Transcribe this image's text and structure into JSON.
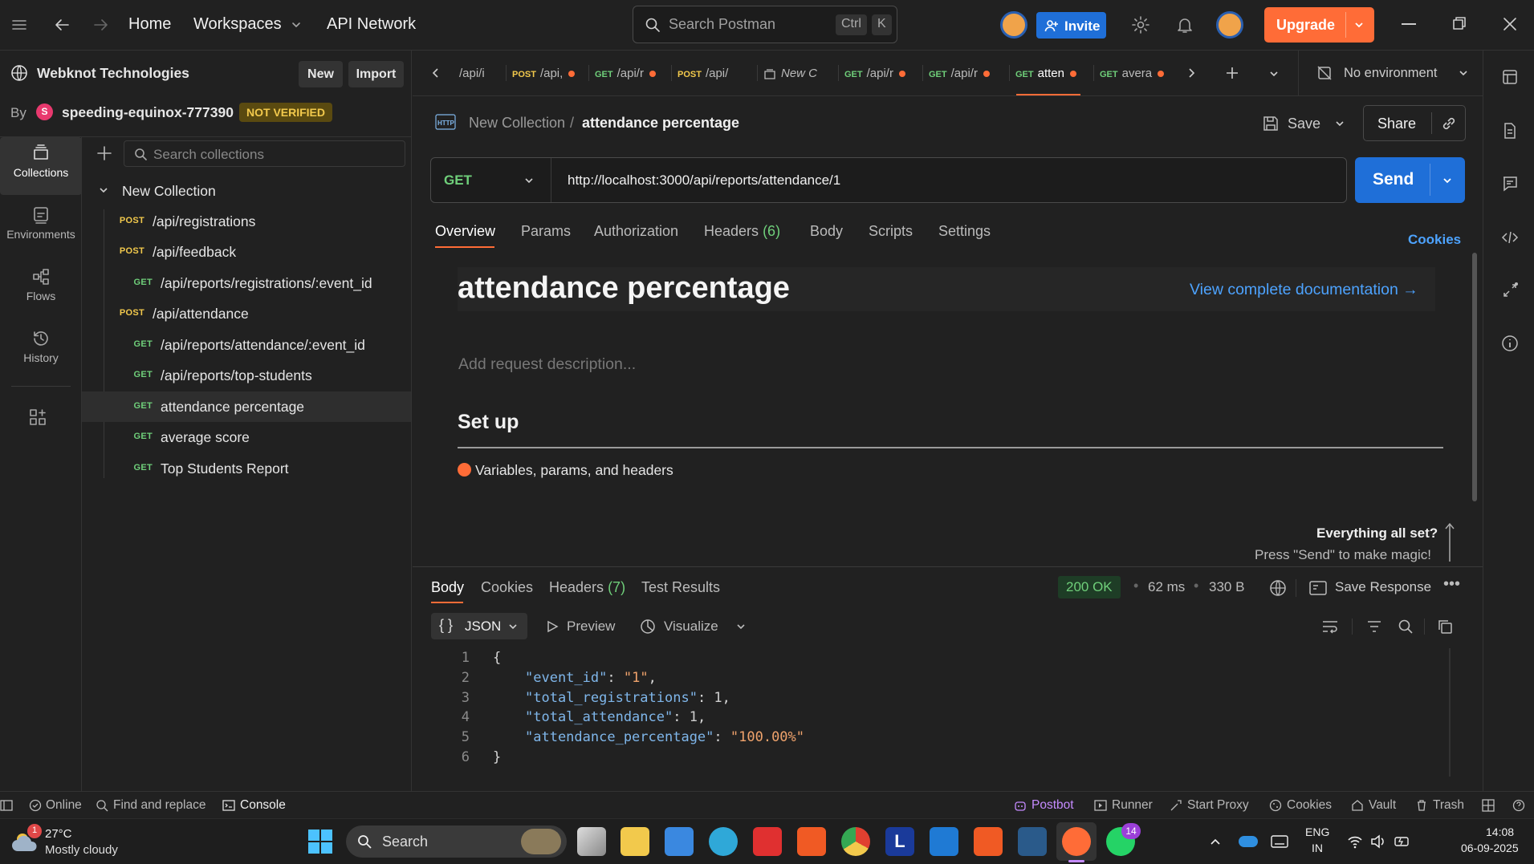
{
  "topbar": {
    "home": "Home",
    "workspaces": "Workspaces",
    "api_network": "API Network",
    "search_placeholder": "Search Postman",
    "kbd_ctrl": "Ctrl",
    "kbd_k": "K",
    "invite": "Invite",
    "upgrade": "Upgrade"
  },
  "workspace": {
    "name": "Webknot Technologies",
    "new": "New",
    "import": "Import",
    "by": "By",
    "avatar_letter": "S",
    "user": "speeding-equinox-777390",
    "badge": "NOT VERIFIED"
  },
  "rail": {
    "items": [
      {
        "label": "Collections",
        "icon": "collections-icon"
      },
      {
        "label": "Environments",
        "icon": "environments-icon"
      },
      {
        "label": "Flows",
        "icon": "flows-icon"
      },
      {
        "label": "History",
        "icon": "history-icon"
      }
    ]
  },
  "sidebar": {
    "search_placeholder": "Search collections",
    "collection_name": "New Collection",
    "items": [
      {
        "method": "POST",
        "label": "/api/registrations"
      },
      {
        "method": "POST",
        "label": "/api/feedback"
      },
      {
        "method": "GET",
        "label": "/api/reports/registrations/:event_id"
      },
      {
        "method": "POST",
        "label": "/api/attendance"
      },
      {
        "method": "GET",
        "label": "/api/reports/attendance/:event_id"
      },
      {
        "method": "GET",
        "label": "/api/reports/top-students"
      },
      {
        "method": "GET",
        "label": "attendance percentage"
      },
      {
        "method": "GET",
        "label": "average score"
      },
      {
        "method": "GET",
        "label": "Top Students Report"
      }
    ]
  },
  "tabs": [
    {
      "method": "",
      "label": "/api/i"
    },
    {
      "method": "POST",
      "label": "/api,"
    },
    {
      "method": "GET",
      "label": "/api/r"
    },
    {
      "method": "POST",
      "label": "/api/"
    },
    {
      "method": "",
      "label": "New C"
    },
    {
      "method": "GET",
      "label": "/api/r"
    },
    {
      "method": "GET",
      "label": "/api/r"
    },
    {
      "method": "GET",
      "label": "atten"
    },
    {
      "method": "GET",
      "label": "avera"
    }
  ],
  "environment": "No environment",
  "request": {
    "breadcrumb_parent": "New Collection",
    "breadcrumb_sep": "/",
    "title": "attendance percentage",
    "save": "Save",
    "share": "Share",
    "method": "GET",
    "url": "http://localhost:3000/api/reports/attendance/1",
    "send": "Send",
    "tabs": [
      "Overview",
      "Params",
      "Authorization",
      "Headers",
      "Body",
      "Scripts",
      "Settings"
    ],
    "headers_count": "(6)",
    "cookies": "Cookies"
  },
  "doc": {
    "title": "attendance percentage",
    "view_docs": "View complete documentation →",
    "desc_placeholder": "Add request description...",
    "setup": "Set up",
    "setup_item": "Variables, params, and headers",
    "ready_title": "Everything all set?",
    "ready_sub": "Press \"Send\" to make magic!"
  },
  "response": {
    "tabs": [
      "Body",
      "Cookies",
      "Headers",
      "Test Results"
    ],
    "headers_count": "(7)",
    "status": "200 OK",
    "time": "62 ms",
    "size": "330 B",
    "save_response": "Save Response",
    "format": "JSON",
    "preview": "Preview",
    "visualize": "Visualize",
    "lines": [
      "1",
      "2",
      "3",
      "4",
      "5",
      "6"
    ],
    "json": {
      "event_id_key": "\"event_id\"",
      "event_id_val": "\"1\"",
      "total_registrations_key": "\"total_registrations\"",
      "total_registrations_val": "1",
      "total_attendance_key": "\"total_attendance\"",
      "total_attendance_val": "1",
      "attendance_percentage_key": "\"attendance_percentage\"",
      "attendance_percentage_val": "\"100.00%\""
    }
  },
  "statusbar": {
    "online": "Online",
    "find_replace": "Find and replace",
    "console": "Console",
    "postbot": "Postbot",
    "runner": "Runner",
    "start_proxy": "Start Proxy",
    "cookies": "Cookies",
    "vault": "Vault",
    "trash": "Trash"
  },
  "taskbar": {
    "weather_badge": "1",
    "temp": "27°C",
    "weather": "Mostly cloudy",
    "search": "Search",
    "whatsapp_badge": "14",
    "lang1": "ENG",
    "lang2": "IN",
    "time": "14:08",
    "date": "06-09-2025"
  },
  "colors": {
    "accent_orange": "#ff6c37",
    "accent_blue": "#1f6fd8",
    "post": "#f2c94c",
    "get": "#6fcf7a"
  }
}
